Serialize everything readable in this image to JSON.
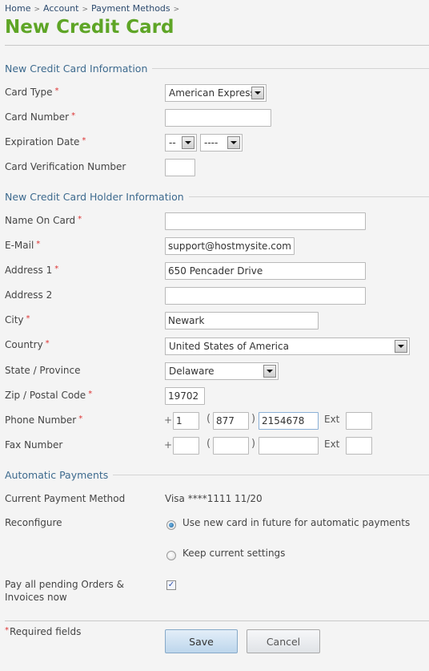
{
  "breadcrumb": [
    "Home",
    "Account",
    "Payment Methods"
  ],
  "breadcrumb_separator": ">",
  "page_title": "New Credit Card",
  "required_marker": "*",
  "sections": {
    "card_info": "New Credit Card Information",
    "holder_info": "New Credit Card Holder Information",
    "auto_payments": "Automatic Payments"
  },
  "card_info": {
    "card_type": {
      "label": "Card Type",
      "value": "American Express"
    },
    "card_number": {
      "label": "Card Number",
      "value": ""
    },
    "expiration": {
      "label": "Expiration Date",
      "month": "--",
      "year": "----"
    },
    "cvn": {
      "label": "Card Verification Number",
      "value": ""
    }
  },
  "holder_info": {
    "name": {
      "label": "Name On Card",
      "value": ""
    },
    "email": {
      "label": "E-Mail",
      "value": "support@hostmysite.com"
    },
    "address1": {
      "label": "Address 1",
      "value": "650 Pencader Drive"
    },
    "address2": {
      "label": "Address 2",
      "value": ""
    },
    "city": {
      "label": "City",
      "value": "Newark"
    },
    "country": {
      "label": "Country",
      "value": "United States of America"
    },
    "state": {
      "label": "State / Province",
      "value": "Delaware"
    },
    "zip": {
      "label": "Zip / Postal Code",
      "value": "19702"
    },
    "phone": {
      "label": "Phone Number",
      "country_code": "1",
      "area_code": "877",
      "number": "2154678",
      "ext": ""
    },
    "fax": {
      "label": "Fax Number",
      "country_code": "",
      "area_code": "",
      "number": "",
      "ext": ""
    },
    "plus": "+",
    "open_paren": "(",
    "close_paren": ")",
    "ext_label": "Ext"
  },
  "auto_payments": {
    "current_label": "Current Payment Method",
    "current_value": "Visa ****1111 11/20",
    "reconfigure_label": "Reconfigure",
    "options": [
      {
        "label": "Use new card in future for automatic payments",
        "selected": true
      },
      {
        "label": "Keep current settings",
        "selected": false
      }
    ],
    "pay_pending_label_line1": "Pay all pending Orders &",
    "pay_pending_label_line2": "Invoices now",
    "pay_pending_checked": true,
    "check_glyph": "✓"
  },
  "footer": {
    "required_note": "Required fields",
    "save_label": "Save",
    "cancel_label": "Cancel"
  },
  "colors": {
    "title_green": "#5ea526",
    "section_blue": "#3d6a8e",
    "required_red": "#dd3333"
  }
}
